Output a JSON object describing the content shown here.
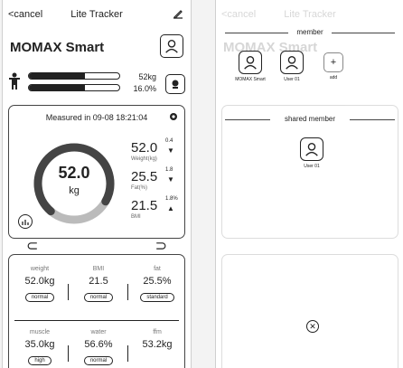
{
  "nav": {
    "cancel": "<cancel",
    "title": "Lite Tracker",
    "edit_icon": "edit-icon"
  },
  "device": {
    "name": "MOMAX Smart"
  },
  "summary": {
    "weight": "52kg",
    "fat": "16.0%",
    "weight_fill": 0.62,
    "fat_fill": 0.62
  },
  "measure": {
    "time": "Measured in 09-08 18:21:04",
    "ring_value": "52.0",
    "ring_unit": "kg",
    "ring_fill": 0.72,
    "metrics": [
      {
        "value": "52.0",
        "label": "Weight(kg)",
        "delta": "0.4",
        "dir": "▼"
      },
      {
        "value": "25.5",
        "label": "Fat(%)",
        "delta": "1.8",
        "dir": "▼"
      },
      {
        "value": "21.5",
        "label": "BMI",
        "delta": "1.8%",
        "dir": "▲"
      }
    ]
  },
  "details": [
    {
      "label": "weight",
      "value": "52.0kg",
      "badge": "normal"
    },
    {
      "label": "BMI",
      "value": "21.5",
      "badge": "normal"
    },
    {
      "label": "fat",
      "value": "25.5%",
      "badge": "standard"
    },
    {
      "label": "muscle",
      "value": "35.0kg",
      "badge": "high"
    },
    {
      "label": "water",
      "value": "56.6%",
      "badge": "normal"
    },
    {
      "label": "ffm",
      "value": "53.2kg",
      "badge": ""
    }
  ],
  "overlay": {
    "member_title": "member",
    "members": [
      "MOMAX Smart",
      "User 01"
    ],
    "add_label": "add",
    "shared_title": "shared member",
    "shared_members": [
      "User 01"
    ],
    "close_icon": "close-icon"
  }
}
